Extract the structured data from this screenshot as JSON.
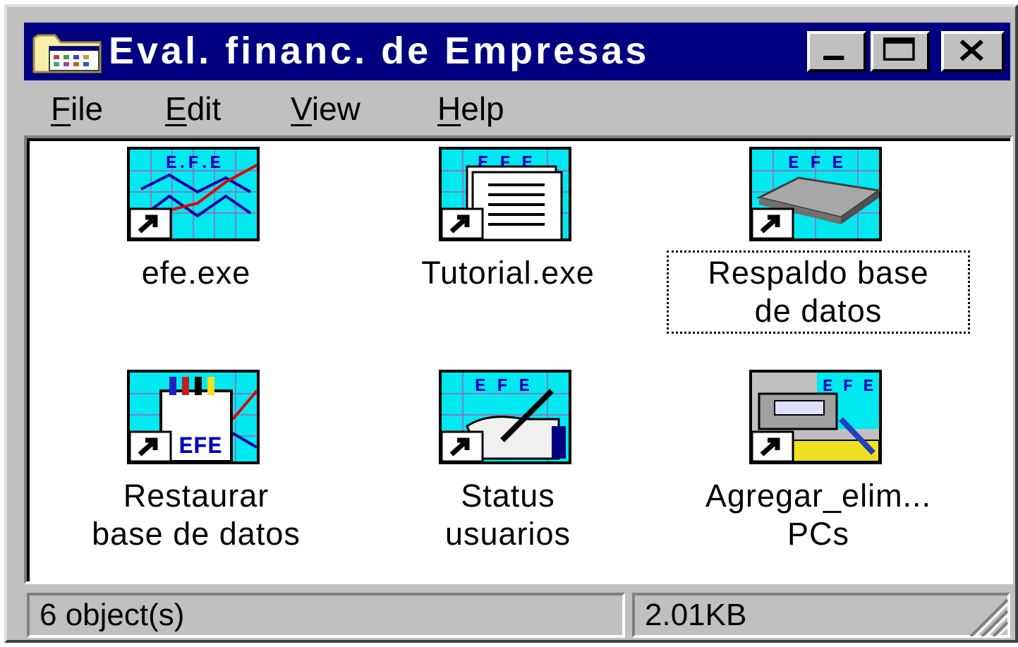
{
  "window": {
    "title": "Eval. financ. de Empresas",
    "icon": "folder-program-icon"
  },
  "title_controls": {
    "minimize": "minimize-icon",
    "maximize": "maximize-icon",
    "close": "close-icon"
  },
  "menu": [
    {
      "mnemonic": "F",
      "rest": "ile"
    },
    {
      "mnemonic": "E",
      "rest": "dit"
    },
    {
      "mnemonic": "V",
      "rest": "iew"
    },
    {
      "mnemonic": "H",
      "rest": "elp"
    }
  ],
  "items": [
    {
      "label": "efe.exe",
      "icon": "efe-chart-shortcut-icon"
    },
    {
      "label": "Tutorial.exe",
      "icon": "efe-document-shortcut-icon"
    },
    {
      "label_line1": "Respaldo base",
      "label_line2": "de datos",
      "icon": "efe-backup-shortcut-icon",
      "focused": true
    },
    {
      "label_line1": "Restaurar",
      "label_line2": "base de datos",
      "icon": "efe-restore-shortcut-icon"
    },
    {
      "label_line1": "Status",
      "label_line2": "usuarios",
      "icon": "efe-status-shortcut-icon"
    },
    {
      "label_line1": "Agregar_elim...",
      "label_line2": "PCs",
      "icon": "efe-pcs-shortcut-icon"
    }
  ],
  "status": {
    "objects": "6 object(s)",
    "size": "2.01KB"
  },
  "colors": {
    "titlebar": "#000080",
    "face": "#c0c0c0",
    "icon_bg": "#00e8f0"
  }
}
